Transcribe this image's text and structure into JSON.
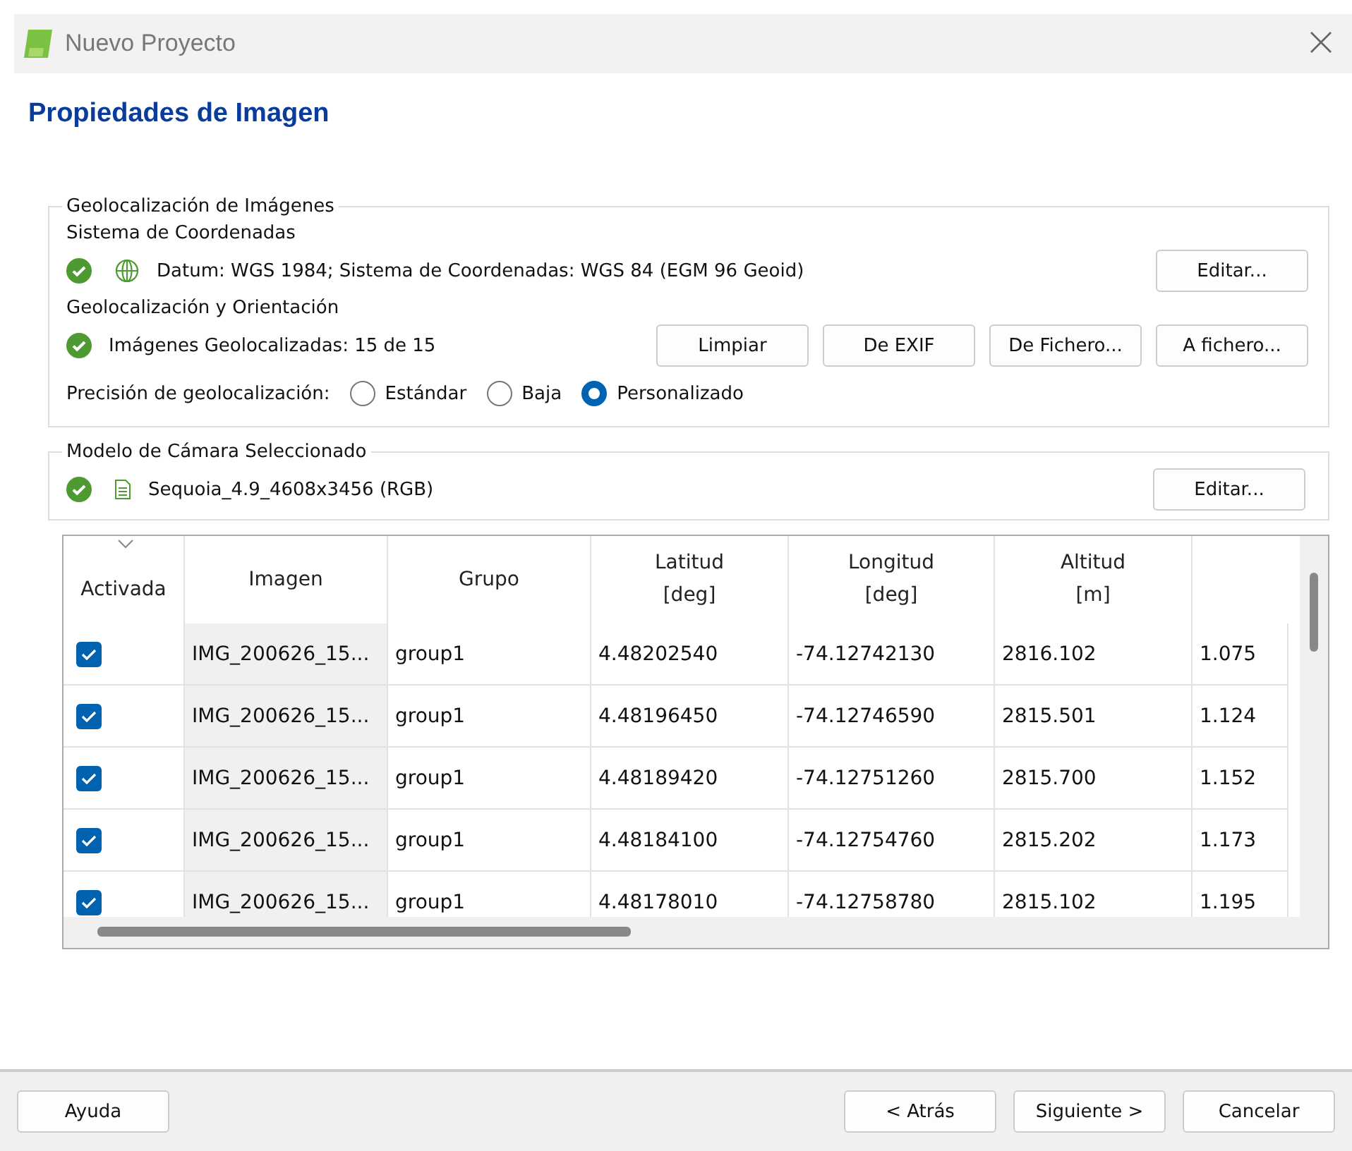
{
  "window": {
    "title": "Nuevo Proyecto"
  },
  "heading": "Propiedades de Imagen",
  "geolocation_group": {
    "title": "Geolocalización de Imágenes",
    "coord_label": "Sistema de Coordenadas",
    "coord_status": {
      "ok": true,
      "text": "Datum: WGS 1984; Sistema de Coordenadas: WGS 84 (EGM 96 Geoid)"
    },
    "coord_button": "Editar...",
    "orient_label": "Geolocalización y Orientación",
    "orient_status": {
      "ok": true,
      "text": "Imágenes Geolocalizadas: 15 de 15"
    },
    "orient_buttons": [
      "Limpiar",
      "De EXIF",
      "De Fichero...",
      "A fichero..."
    ],
    "accuracy_label": "Precisión de geolocalización:",
    "accuracy_options": [
      {
        "label": "Estándar",
        "selected": false
      },
      {
        "label": "Baja",
        "selected": false
      },
      {
        "label": "Personalizado",
        "selected": true
      }
    ]
  },
  "camera_group": {
    "title": "Modelo de Cámara Seleccionado",
    "status": {
      "ok": true,
      "text": "Sequoia_4.9_4608x3456 (RGB)"
    },
    "button": "Editar..."
  },
  "table": {
    "check_column": "Activada",
    "columns": [
      {
        "lines": [
          "Imagen"
        ]
      },
      {
        "lines": [
          "Grupo"
        ]
      },
      {
        "lines": [
          "Latitud",
          "[deg]"
        ]
      },
      {
        "lines": [
          "Longitud",
          "[deg]"
        ]
      },
      {
        "lines": [
          "Altitud",
          "[m]"
        ]
      }
    ],
    "rows": [
      {
        "checked": true,
        "cells": [
          "IMG_200626_15...",
          "group1",
          "4.48202540",
          "-74.12742130",
          "2816.102",
          "1.075"
        ]
      },
      {
        "checked": true,
        "cells": [
          "IMG_200626_15...",
          "group1",
          "4.48196450",
          "-74.12746590",
          "2815.501",
          "1.124"
        ]
      },
      {
        "checked": true,
        "cells": [
          "IMG_200626_15...",
          "group1",
          "4.48189420",
          "-74.12751260",
          "2815.700",
          "1.152"
        ]
      },
      {
        "checked": true,
        "cells": [
          "IMG_200626_15...",
          "group1",
          "4.48184100",
          "-74.12754760",
          "2815.202",
          "1.173"
        ]
      },
      {
        "checked": true,
        "cells": [
          "IMG_200626_15...",
          "group1",
          "4.48178010",
          "-74.12758780",
          "2815.102",
          "1.195"
        ]
      }
    ]
  },
  "footer": {
    "left_button": "Ayuda",
    "right_buttons": [
      "< Atrás",
      "Siguiente >",
      "Cancelar"
    ]
  }
}
